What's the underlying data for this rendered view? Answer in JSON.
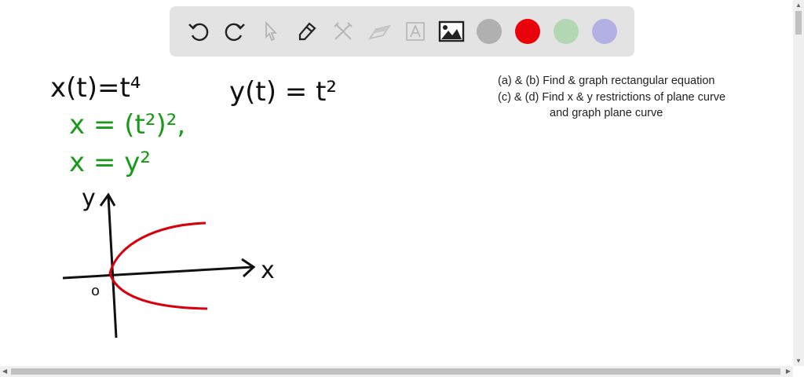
{
  "toolbar": {
    "tools": [
      "undo",
      "redo",
      "select",
      "pen",
      "tools",
      "eraser",
      "text",
      "image"
    ],
    "colors": [
      {
        "name": "gray",
        "hex": "#b0b0b0"
      },
      {
        "name": "red",
        "hex": "#e8000b"
      },
      {
        "name": "green",
        "hex": "#b3d6b3"
      },
      {
        "name": "purple",
        "hex": "#b3b0e3"
      }
    ]
  },
  "notes": {
    "line1": "(a) & (b) Find & graph rectangular equation",
    "line2": "(c) & (d) Find x & y restrictions of plane curve",
    "line3": "and graph plane curve"
  },
  "handwriting": {
    "eq1": "x(t)=t⁴",
    "eq2": "y(t) = t²",
    "eq3": "x = (t²)²,",
    "eq4": "x = y²",
    "axis_y": "y",
    "axis_x": "x",
    "origin": "o"
  },
  "ink_colors": {
    "black": "#111111",
    "green": "#1a9a1a",
    "red": "#d8000c"
  }
}
